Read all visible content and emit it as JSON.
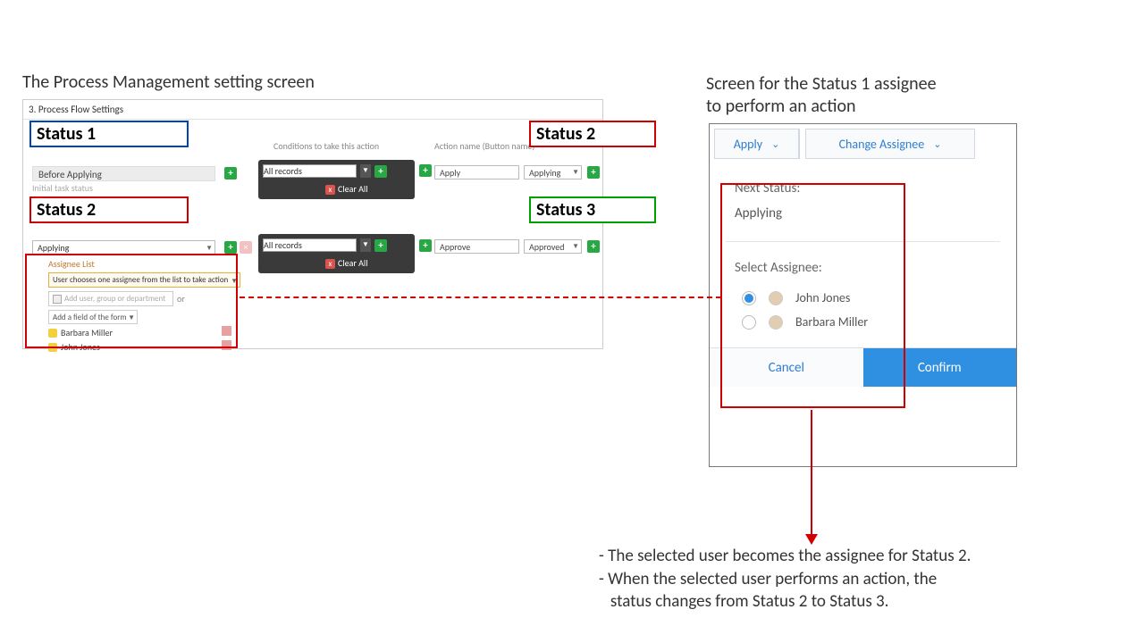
{
  "captions": {
    "left": "The Process Management setting screen",
    "right": "Screen for the Status 1 assignee\n to perform an action"
  },
  "leftPanel": {
    "header": "3. Process Flow Settings",
    "columns": {
      "conditions": "Conditions to take this action",
      "action": "Action name (Button name)"
    },
    "row1": {
      "status": "Before Applying",
      "initialNote": "Initial task status",
      "condition": "All records",
      "clearAll": "Clear All",
      "actionName": "Apply",
      "statusAfter": "Applying"
    },
    "row2": {
      "status": "Applying",
      "condition": "All records",
      "clearAll": "Clear All",
      "actionName": "Approve",
      "statusAfter": "Approved"
    },
    "assignee": {
      "header": "Assignee List",
      "mode": "User chooses one assignee from the list to take action",
      "addUserPlaceholder": "Add user, group or department",
      "or": "or",
      "addField": "Add a field of the form",
      "users": [
        "Barbara Miller",
        "John Jones"
      ]
    }
  },
  "rightPanel": {
    "apply": "Apply",
    "changeAssignee": "Change Assignee",
    "nextStatusLabel": "Next Status:",
    "nextStatusValue": "Applying",
    "selectAssigneeLabel": "Select Assignee:",
    "options": [
      {
        "name": "John Jones",
        "selected": true
      },
      {
        "name": "Barbara Miller",
        "selected": false
      }
    ],
    "cancel": "Cancel",
    "confirm": "Confirm"
  },
  "callouts": {
    "s1": "Status 1",
    "s2top": "Status 2",
    "s2left": "Status 2",
    "s3": "Status 3"
  },
  "notes": {
    "l1": "- The selected user becomes the assignee for Status 2.",
    "l2": "- When the selected user performs an action, the",
    "l3": "   status changes from Status 2 to Status 3."
  }
}
